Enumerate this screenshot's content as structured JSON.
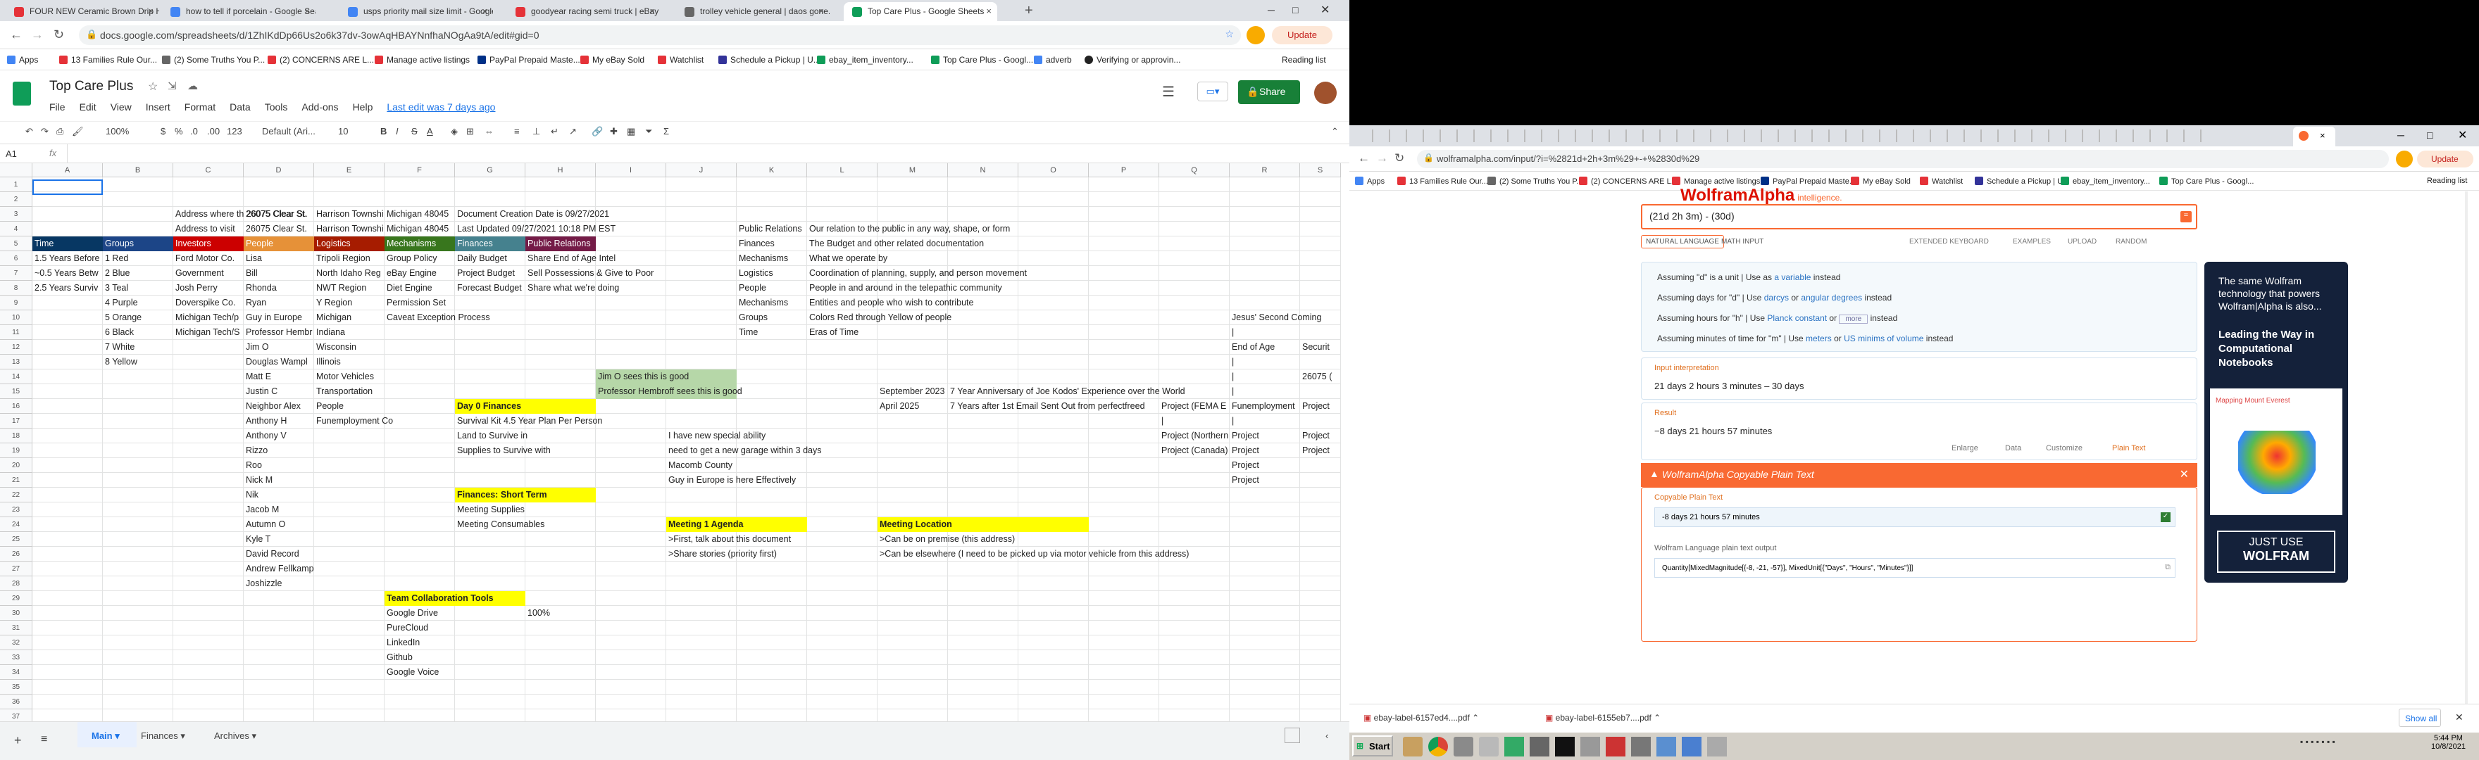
{
  "left_browser": {
    "tabs": [
      {
        "label": "FOUR NEW Ceramic Brown Drip Ho...",
        "color": "#e53238"
      },
      {
        "label": "how to tell if porcelain - Google Sea...",
        "color": "#4285f4"
      },
      {
        "label": "usps priority mail size limit - Google ...",
        "color": "#4285f4"
      },
      {
        "label": "goodyear racing semi truck | eBay",
        "color": "#e53238"
      },
      {
        "label": "trolley vehicle general | daos gone...",
        "color": "#666"
      },
      {
        "label": "Top Care Plus - Google Sheets",
        "color": "#0f9d58"
      }
    ],
    "new_tab": "+",
    "url": "docs.google.com/spreadsheets/d/1ZhIKdDp66Us2o6k37dv-3owAqHBAYNnfhaNOgAa9tA/edit#gid=0",
    "update_label": "Update",
    "bookmarks": [
      {
        "label": "Apps",
        "color": "#4285f4"
      },
      {
        "label": "13 Families Rule Our...",
        "color": "#e53238"
      },
      {
        "label": "(2) Some Truths You P...",
        "color": "#666"
      },
      {
        "label": "(2) CONCERNS ARE L...",
        "color": "#e53238"
      },
      {
        "label": "Manage active listings",
        "color": "#e53238"
      },
      {
        "label": "PayPal Prepaid Maste...",
        "color": "#003087"
      },
      {
        "label": "My eBay Sold",
        "color": "#e53238"
      },
      {
        "label": "Watchlist",
        "color": "#e53238"
      },
      {
        "label": "Schedule a Pickup | U...",
        "color": "#333399"
      },
      {
        "label": "ebay_item_inventory...",
        "color": "#0f9d58"
      },
      {
        "label": "Top Care Plus - Googl...",
        "color": "#0f9d58"
      },
      {
        "label": "adverb",
        "color": "#4285f4"
      },
      {
        "label": "Verifying or approvin...",
        "color": "#222"
      }
    ],
    "reading_list": "Reading list"
  },
  "sheets": {
    "title": "Top Care Plus",
    "menu": [
      "File",
      "Edit",
      "View",
      "Insert",
      "Format",
      "Data",
      "Tools",
      "Add-ons",
      "Help"
    ],
    "last_edit": "Last edit was 7 days ago",
    "share_label": "Share",
    "toolbar": {
      "zoom": "100%",
      "currency": "$",
      "percent": "%",
      ".0": ".0",
      ".00": ".00",
      "numfmt": "123",
      "font": "Default (Ari...",
      "size": "10",
      "bold": "B",
      "italic": "I",
      "strike": "S",
      "underline": "A"
    },
    "name_box": "A1",
    "fx": "fx",
    "columns": [
      "A",
      "B",
      "C",
      "D",
      "E",
      "F",
      "G",
      "H",
      "I",
      "J",
      "K",
      "L",
      "M",
      "N",
      "O",
      "P",
      "Q",
      "R",
      "S"
    ],
    "rows": [
      "1",
      "2",
      "3",
      "4",
      "5",
      "6",
      "7",
      "8",
      "9",
      "10",
      "11",
      "12",
      "13",
      "14",
      "15",
      "16",
      "17",
      "18",
      "19",
      "20",
      "21",
      "22",
      "23",
      "24",
      "25",
      "26",
      "27",
      "28",
      "29",
      "30",
      "31",
      "32",
      "33",
      "34",
      "35",
      "36",
      "37"
    ],
    "sheet_tabs": [
      "Main",
      "Finances",
      "Archives"
    ],
    "cells": {
      "r3_c": "Address where th 26075 Clear St.",
      "r3_d": "26075 Clear St.",
      "r3_e": "Harrison Townshi",
      "r3_f": "Michigan 48045",
      "r3_g": "Document Creation Date is 09/27/2021",
      "r4_c": "Address to visit",
      "r4_d": "26075 Clear St.",
      "r4_e": "Harrison Townshi",
      "r4_f": "Michigan 48045",
      "r4_g": "Last Updated 09/27/2021 10:18 PM EST",
      "r4_k": "Public Relations",
      "r4_l": "Our relation to the public in any way, shape, or form",
      "r5_a": "Time",
      "r5_b": "Groups",
      "r5_c": "Investors",
      "r5_d": "People",
      "r5_e": "Logistics",
      "r5_f": "Mechanisms",
      "r5_g": "Finances",
      "r5_h": "Public Relations",
      "r5_k": "Finances",
      "r5_l": "The Budget and other related documentation",
      "r6_a": "1.5 Years Before",
      "r6_b": "1 Red",
      "r6_c": "Ford Motor Co.",
      "r6_d": "Lisa",
      "r6_e": "Tripoli Region",
      "r6_f": "Group Policy",
      "r6_g": "Daily Budget",
      "r6_h": "Share End of Age Intel",
      "r6_k": "Mechanisms",
      "r6_l": "What we operate by",
      "r7_a": "~0.5 Years Betw",
      "r7_b": "2 Blue",
      "r7_c": "Government",
      "r7_d": "Bill",
      "r7_e": "North Idaho Reg",
      "r7_f": "eBay Engine",
      "r7_g": "Project Budget",
      "r7_h": "Sell Possessions & Give to Poor",
      "r7_k": "Logistics",
      "r7_l": "Coordination of planning, supply, and person movement",
      "r8_a": "2.5 Years Surviv",
      "r8_b": "3 Teal",
      "r8_c": "Josh Perry",
      "r8_d": "Rhonda",
      "r8_e": "NWT Region",
      "r8_f": "Diet Engine",
      "r8_g": "Forecast Budget",
      "r8_h": "Share what we're doing",
      "r8_k": "People",
      "r8_l": "People in and around in the telepathic community",
      "r9_b": "4 Purple",
      "r9_c": "Doverspike Co.",
      "r9_d": "Ryan",
      "r9_e": "Y Region",
      "r9_f": "Permission Set",
      "r9_k": "Mechanisms",
      "r9_l": "Entities and people who wish to contribute",
      "r10_b": "5 Orange",
      "r10_c": "Michigan Tech/p",
      "r10_d": "Guy in Europe",
      "r10_e": "Michigan",
      "r10_f": "Caveat Exception Process",
      "r10_k": "Groups",
      "r10_l": "Colors Red through Yellow of people",
      "r10_r": "Jesus' Second Coming",
      "r11_b": "6 Black",
      "r11_c": "Michigan Tech/S",
      "r11_d": "Professor Hembr",
      "r11_e": "Indiana",
      "r11_k": "Time",
      "r11_l": "Eras of Time",
      "r11_r": "|",
      "r12_b": "7 White",
      "r12_d": "Jim O",
      "r12_e": "Wisconsin",
      "r12_r": "End of Age",
      "r12_s": "Securit",
      "r13_b": "8 Yellow",
      "r13_d": "Douglas Wampl",
      "r13_e": "Illinois",
      "r13_r": "|",
      "r14_d": "Matt E",
      "r14_e": "Motor Vehicles",
      "r14_i": "Jim O sees this is good",
      "r14_r": "|",
      "r14_s": "26075 (",
      "r15_d": "Justin C",
      "r15_e": "Transportation",
      "r15_i": "Professor Hembroff sees this is good",
      "r15_m": "September 2023",
      "r15_n": "7 Year Anniversary of Joe Kodos' Experience over the World",
      "r15_r": "|",
      "r16_d": "Neighbor Alex",
      "r16_e": "People",
      "r16_g": "Day 0 Finances",
      "r16_m": "April 2025",
      "r16_n": "7 Years after 1st Email Sent Out from perfectfreed",
      "r16_q": "Project (FEMA E",
      "r16_r": "Funemployment",
      "r16_s": "Project",
      "r17_d": "Anthony H",
      "r17_e": "Funemployment Co",
      "r17_g": "Survival Kit 4.5 Year Plan Per Person",
      "r17_q": "|",
      "r17_r": "|",
      "r18_d": "Anthony V",
      "r18_g": "Land to Survive in",
      "r18_j": "I have new special ability",
      "r18_q": "Project (Northern",
      "r18_r": "Project",
      "r18_s": "Project",
      "r19_d": "Rizzo",
      "r19_g": "Supplies to Survive with",
      "r19_j": "need to get a new garage within 3 days",
      "r19_q": "Project (Canada)",
      "r19_r": "Project",
      "r19_s": "Project",
      "r20_d": "Roo",
      "r20_j": "Macomb County",
      "r20_r": "Project",
      "r21_d": "Nick M",
      "r21_j": "Guy in Europe is here Effectively",
      "r21_r": "Project",
      "r22_d": "Nik",
      "r22_g": "Finances: Short Term",
      "r23_d": "Jacob M",
      "r23_g": "Meeting Supplies",
      "r24_d": "Autumn O",
      "r24_g": "Meeting Consumables",
      "r24_j": "Meeting 1 Agenda",
      "r24_m": "Meeting Location",
      "r25_d": "Kyle T",
      "r25_j": ">First, talk about this document",
      "r25_m": ">Can be on premise (this address)",
      "r26_d": "David Record",
      "r26_j": ">Share stories (priority first)",
      "r26_m": ">Can be elsewhere (I need to be picked up via motor vehicle from this address)",
      "r27_d": "Andrew Fellkamp",
      "r28_d": "Joshizzle",
      "r29_f": "Team Collaboration Tools",
      "r30_f": "Google Drive",
      "r30_h": "100%",
      "r31_f": "PureCloud",
      "r32_f": "LinkedIn",
      "r33_f": "Github",
      "r34_f": "Google Voice"
    }
  },
  "right_browser": {
    "url": "wolframalpha.com/input/?i=%2821d+2h+3m%29+-+%2830d%29",
    "update_label": "Update",
    "bookmarks": [
      {
        "label": "Apps",
        "color": "#4285f4"
      },
      {
        "label": "13 Families Rule Our...",
        "color": "#e53238"
      },
      {
        "label": "(2) Some Truths You P...",
        "color": "#666"
      },
      {
        "label": "(2) CONCERNS ARE L...",
        "color": "#e53238"
      },
      {
        "label": "Manage active listings",
        "color": "#e53238"
      },
      {
        "label": "PayPal Prepaid Maste...",
        "color": "#003087"
      },
      {
        "label": "My eBay Sold",
        "color": "#e53238"
      },
      {
        "label": "Watchlist",
        "color": "#e53238"
      },
      {
        "label": "Schedule a Pickup | U...",
        "color": "#333399"
      },
      {
        "label": "ebay_item_inventory...",
        "color": "#0f9d58"
      },
      {
        "label": "Top Care Plus - Googl...",
        "color": "#0f9d58"
      }
    ],
    "reading_list": "Reading list"
  },
  "wolfram": {
    "logo_text": "WolframAlpha",
    "logo_tagline": "intelligence.",
    "query": "(21d 2h 3m) - (30d)",
    "input_modes": [
      "NATURAL LANGUAGE",
      "MATH INPUT"
    ],
    "tools": [
      "EXTENDED KEYBOARD",
      "EXAMPLES",
      "UPLOAD",
      "RANDOM"
    ],
    "assumptions": [
      {
        "pre": "Assuming \"d\" is a unit",
        "sep": " | Use as ",
        "link": "a variable",
        "post": " instead"
      },
      {
        "pre": "Assuming days for \"d\"",
        "sep": " | Use ",
        "link": "darcys",
        "mid": " or ",
        "link2": "angular degrees",
        "post": " instead"
      },
      {
        "pre": "Assuming hours for \"h\"",
        "sep": " | Use ",
        "link": "Planck constant",
        "mid": " or ",
        "select": "more",
        "post": " instead"
      },
      {
        "pre": "Assuming minutes of time for \"m\"",
        "sep": " | Use ",
        "link": "meters",
        "mid": " or ",
        "link2": "US minims of volume",
        "post": " instead"
      }
    ],
    "input_interpretation_label": "Input interpretation",
    "input_interpretation": "21 days  2 hours  3 minutes – 30 days",
    "result_label": "Result",
    "result": "−8 days  21 hours  57 minutes",
    "result_actions": [
      "Enlarge",
      "Data",
      "Customize",
      "Plain Text"
    ],
    "copyable_header": "WolframAlpha Copyable Plain Text",
    "copyable_plain_label": "Copyable Plain Text",
    "copyable_plain_value": "-8 days 21 hours 57 minutes",
    "wl_label": "Wolfram Language plain text output",
    "wl_value": "Quantity[MixedMagnitude[{-8, -21, -57}], MixedUnit[{\"Days\", \"Hours\", \"Minutes\"}]]",
    "ad": {
      "line1": "The same Wolfram technology that powers Wolfram|Alpha is also...",
      "line2": "Leading the Way in Computational Notebooks",
      "chart_title": "Mapping Mount Everest",
      "cta1": "JUST USE",
      "cta2": "WOLFRAM"
    }
  },
  "downloads": {
    "items": [
      "ebay-label-6157ed4....pdf",
      "ebay-label-6155eb7....pdf"
    ],
    "show_all": "Show all"
  },
  "taskbar": {
    "start": "Start",
    "time": "5:44 PM",
    "date": "10/8/2021"
  }
}
